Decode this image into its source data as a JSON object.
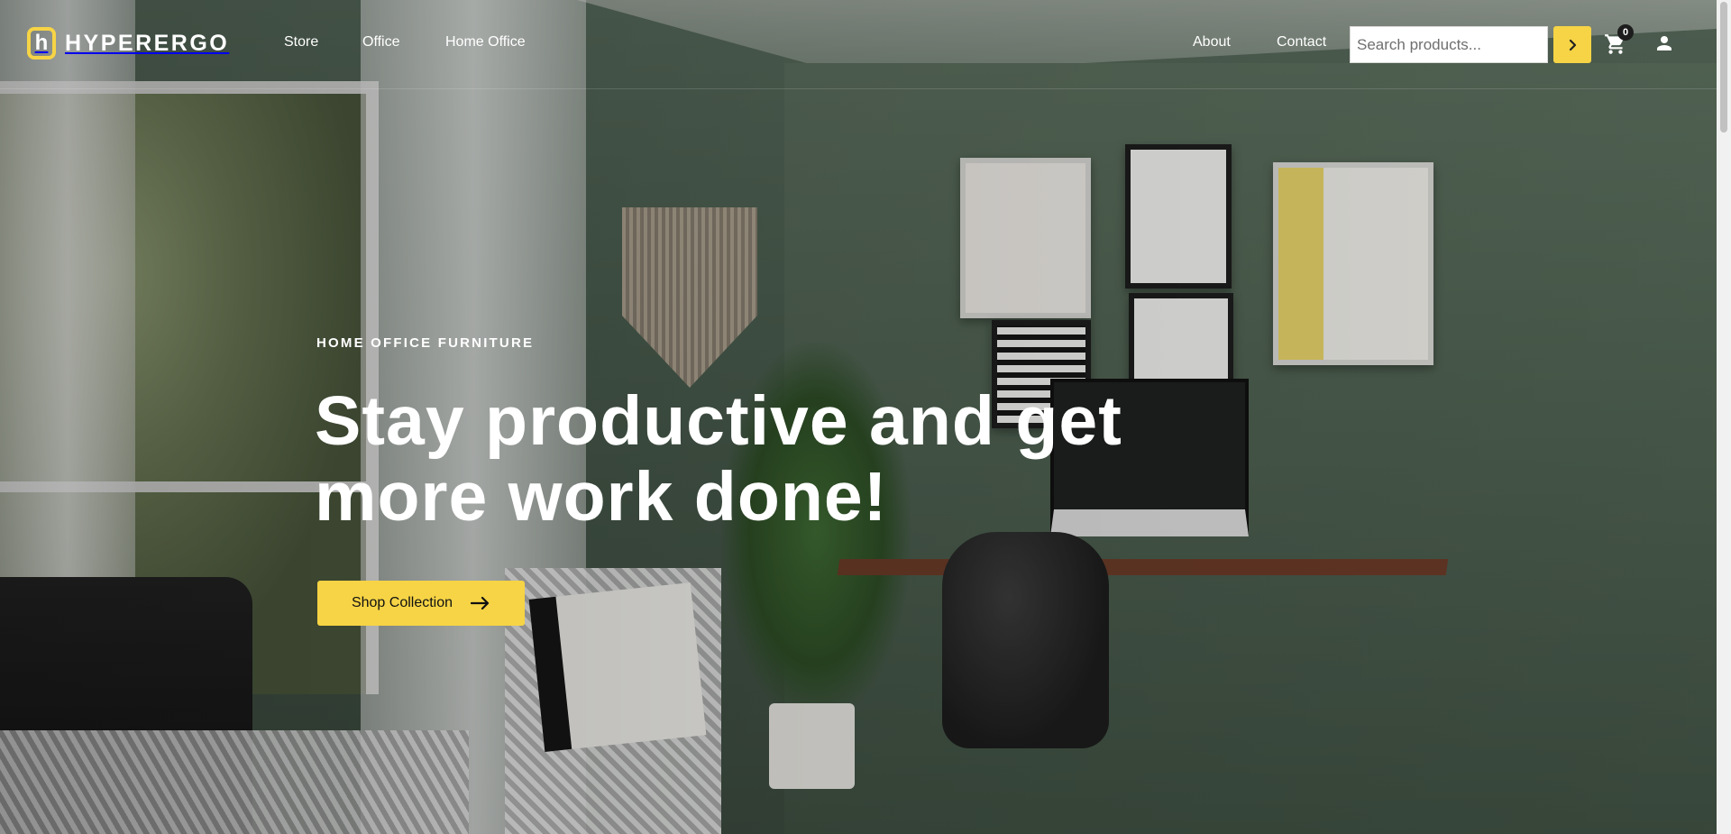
{
  "brand": {
    "logo_letter": "h",
    "name": "HYPERERGO",
    "accent_color": "#f6d445"
  },
  "nav": {
    "left": [
      {
        "label": "Store"
      },
      {
        "label": "Office"
      },
      {
        "label": "Home Office"
      }
    ],
    "right": [
      {
        "label": "About"
      },
      {
        "label": "Contact"
      }
    ]
  },
  "search": {
    "placeholder": "Search products...",
    "value": "",
    "submit_icon": "chevron-right-icon"
  },
  "cart": {
    "icon": "cart-icon",
    "count": "0"
  },
  "account": {
    "icon": "user-icon"
  },
  "hero": {
    "eyebrow": "HOME OFFICE FURNITURE",
    "headline_line1": "Stay productive and get",
    "headline_line2": "more work done!",
    "cta_label": "Shop Collection",
    "cta_icon": "arrow-right-icon"
  }
}
